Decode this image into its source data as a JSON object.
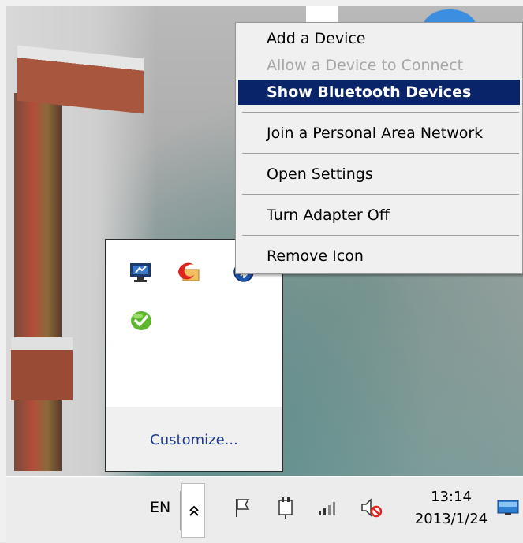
{
  "context_menu": {
    "items": [
      {
        "label": "Add a Device",
        "state": "normal"
      },
      {
        "label": "Allow a Device to Connect",
        "state": "disabled"
      },
      {
        "label": "Show Bluetooth Devices",
        "state": "selected"
      },
      {
        "label": "Join a Personal Area Network",
        "state": "normal"
      },
      {
        "label": "Open Settings",
        "state": "normal"
      },
      {
        "label": "Turn Adapter Off",
        "state": "normal"
      },
      {
        "label": "Remove Icon",
        "state": "normal"
      }
    ]
  },
  "tray_flyout": {
    "icons": [
      "network-monitor-icon",
      "red-swirl-app-icon",
      "bluetooth-icon",
      "green-check-chat-icon"
    ],
    "customize_label": "Customize..."
  },
  "taskbar": {
    "language": "EN",
    "time": "13:14",
    "date": "2013/1/24",
    "tray_icons": [
      "action-center-flag-icon",
      "power-plug-icon",
      "network-signal-icon",
      "volume-muted-icon",
      "show-desktop-icon"
    ]
  },
  "colors": {
    "menu_highlight": "#0a246a",
    "link_blue": "#1c3a8c",
    "muted_red": "#e0261c"
  }
}
